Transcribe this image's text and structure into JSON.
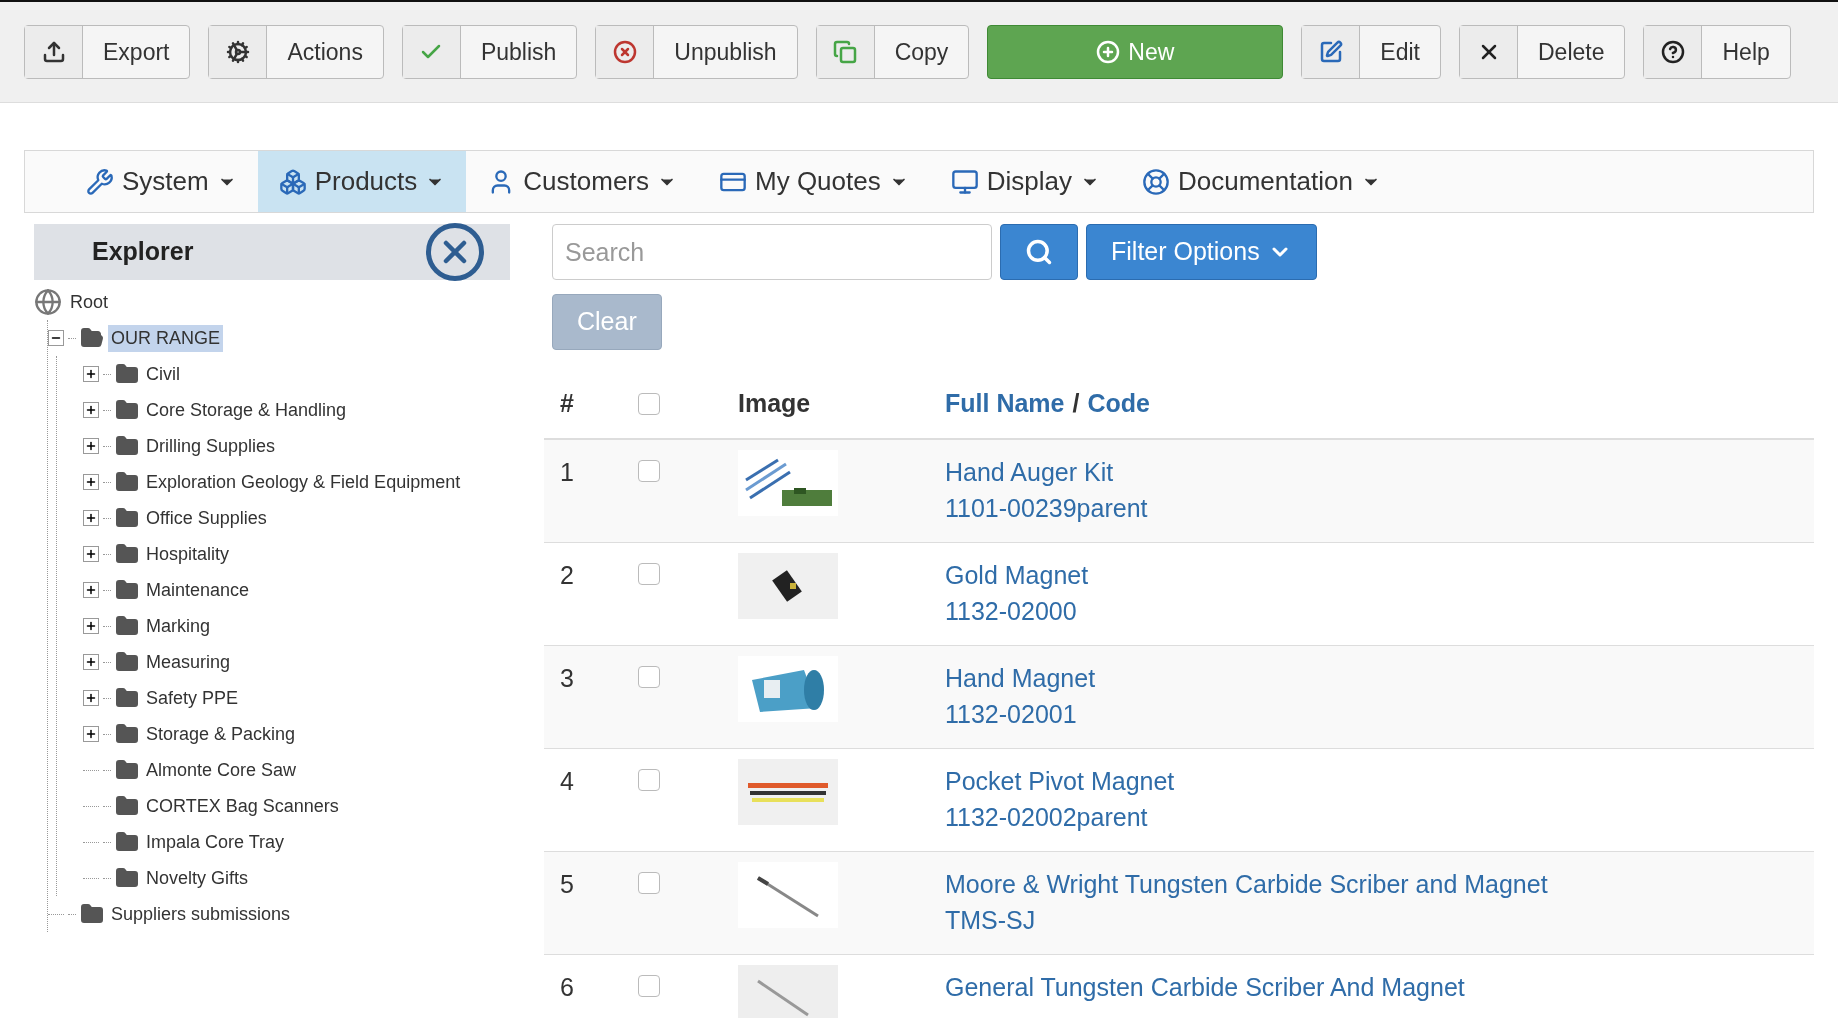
{
  "toolbar": [
    {
      "label": "Export",
      "kind": "default"
    },
    {
      "label": "Actions",
      "kind": "default"
    },
    {
      "label": "Publish",
      "kind": "default"
    },
    {
      "label": "Unpublish",
      "kind": "default"
    },
    {
      "label": "Copy",
      "kind": "default"
    },
    {
      "label": "New",
      "kind": "primary"
    },
    {
      "label": "Edit",
      "kind": "default"
    },
    {
      "label": "Delete",
      "kind": "default"
    },
    {
      "label": "Help",
      "kind": "default"
    }
  ],
  "menu": [
    {
      "label": "System",
      "selected": false
    },
    {
      "label": "Products",
      "selected": true
    },
    {
      "label": "Customers",
      "selected": false
    },
    {
      "label": "My Quotes",
      "selected": false
    },
    {
      "label": "Display",
      "selected": false
    },
    {
      "label": "Documentation",
      "selected": false
    }
  ],
  "explorer": {
    "title": "Explorer",
    "tree": {
      "label": "Root",
      "children": [
        {
          "label": "OUR RANGE",
          "selected": true,
          "expanded": true,
          "children": [
            {
              "label": "Civil",
              "selected": false,
              "expanded": false
            },
            {
              "label": "Core Storage & Handling",
              "selected": false,
              "expanded": false
            },
            {
              "label": "Drilling Supplies",
              "selected": false,
              "expanded": false
            },
            {
              "label": "Exploration Geology & Field Equipment",
              "selected": false,
              "expanded": false
            },
            {
              "label": "Office Supplies",
              "selected": false,
              "expanded": false
            },
            {
              "label": "Hospitality",
              "selected": false,
              "expanded": false
            },
            {
              "label": "Maintenance",
              "selected": false,
              "expanded": false
            },
            {
              "label": "Marking",
              "selected": false,
              "expanded": false
            },
            {
              "label": "Measuring",
              "selected": false,
              "expanded": false
            },
            {
              "label": "Safety PPE",
              "selected": false,
              "expanded": false
            },
            {
              "label": "Storage & Packing",
              "selected": false,
              "expanded": false
            },
            {
              "label": "Almonte Core Saw",
              "selected": false
            },
            {
              "label": "CORTEX Bag Scanners",
              "selected": false
            },
            {
              "label": "Impala Core Tray",
              "selected": false
            },
            {
              "label": "Novelty Gifts",
              "selected": false
            }
          ]
        },
        {
          "label": "Suppliers submissions",
          "selected": false
        }
      ]
    }
  },
  "search": {
    "placeholder": "Search",
    "filter_label": "Filter Options",
    "clear_label": "Clear"
  },
  "table": {
    "columns": {
      "number": "#",
      "image": "Image",
      "name": "Full Name",
      "separator": "/",
      "code": "Code"
    },
    "all_checked": false,
    "rows": [
      {
        "number": "1",
        "checked": false,
        "name": "Hand Auger Kit",
        "code": "1101-00239parent"
      },
      {
        "number": "2",
        "checked": false,
        "name": "Gold Magnet",
        "code": "1132-02000"
      },
      {
        "number": "3",
        "checked": false,
        "name": "Hand Magnet",
        "code": "1132-02001"
      },
      {
        "number": "4",
        "checked": false,
        "name": "Pocket Pivot Magnet",
        "code": "1132-02002parent"
      },
      {
        "number": "5",
        "checked": false,
        "name": "Moore & Wright Tungsten Carbide Scriber and Magnet",
        "code": "TMS-SJ"
      },
      {
        "number": "6",
        "checked": false,
        "name": "General Tungsten Carbide Scriber And Magnet"
      }
    ]
  }
}
